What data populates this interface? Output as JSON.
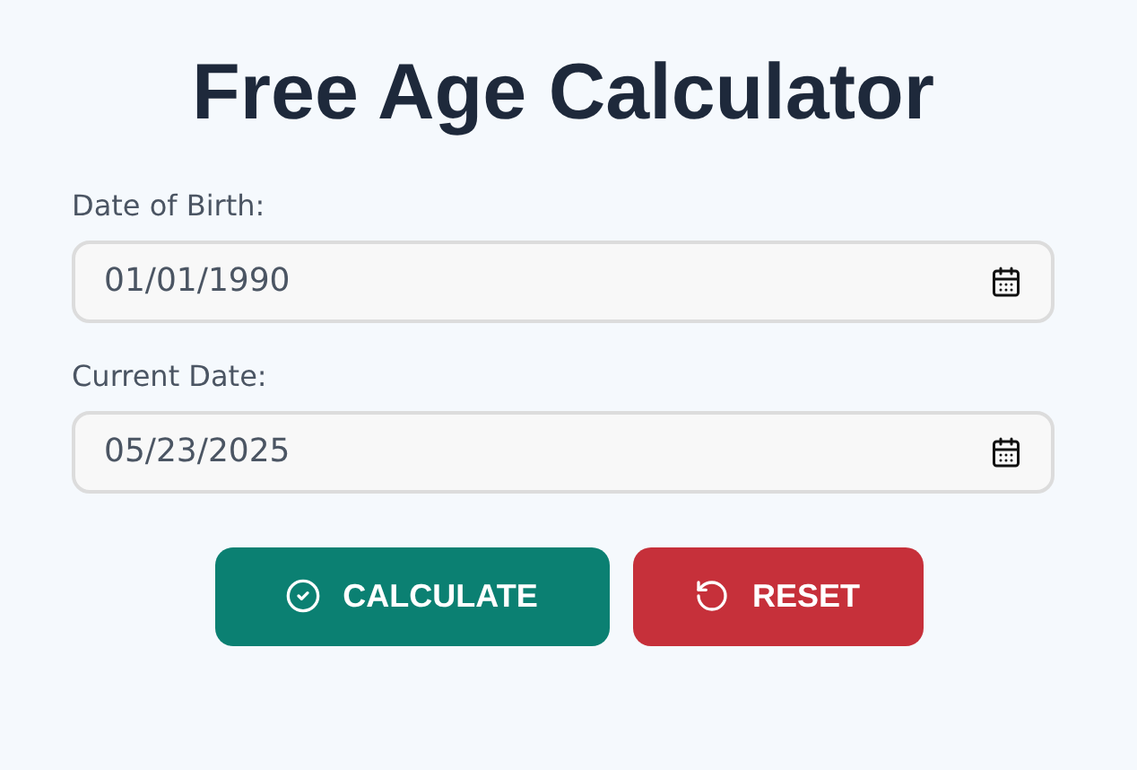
{
  "title": "Free Age Calculator",
  "fields": [
    {
      "label": "Date of Birth:",
      "value": "01/01/1990"
    },
    {
      "label": "Current Date:",
      "value": "05/23/2025"
    }
  ],
  "buttons": [
    {
      "kind": "calculate",
      "label": "CALCULATE"
    },
    {
      "kind": "reset",
      "label": "RESET"
    }
  ]
}
